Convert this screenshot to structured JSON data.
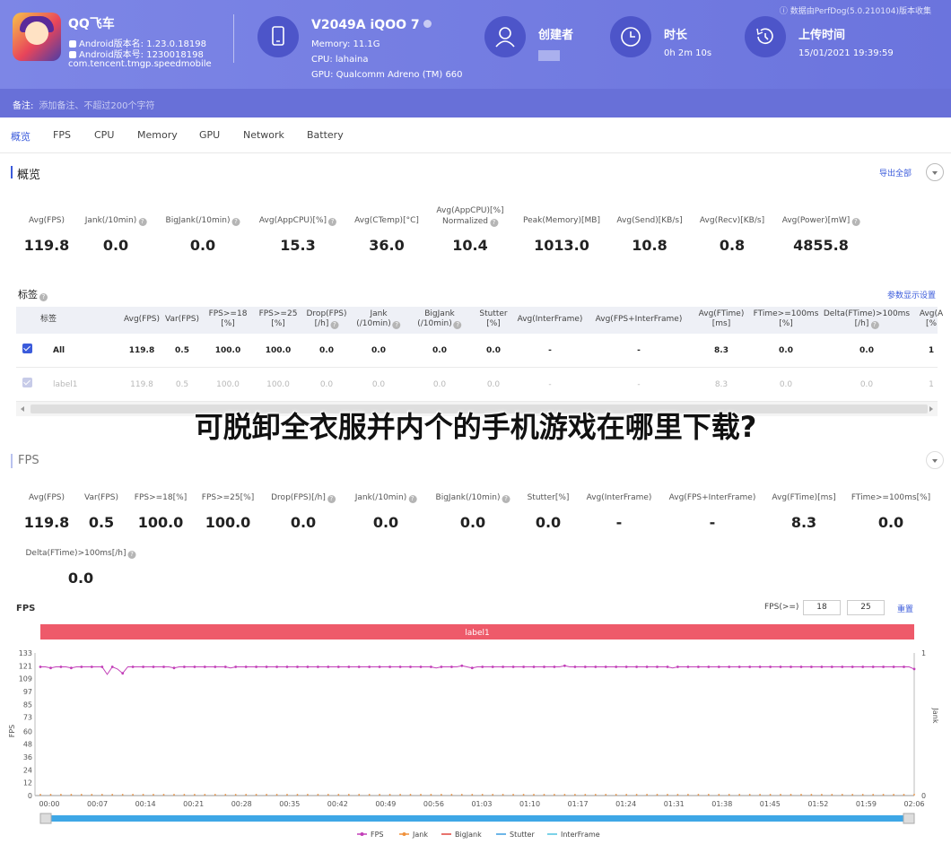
{
  "header": {
    "app_name": "QQ飞车",
    "android_version_name": "Android版本名: 1.23.0.18198",
    "android_version_code": "Android版本号: 1230018198",
    "package": "com.tencent.tmgp.speedmobile",
    "device_name": "V2049A iQOO 7",
    "memory": "Memory: 11.1G",
    "cpu": "CPU: lahaina",
    "gpu": "GPU: Qualcomm Adreno (TM) 660",
    "creator_label": "创建者",
    "duration_label": "时长",
    "duration_value": "0h 2m 10s",
    "upload_label": "上传时间",
    "upload_value": "15/01/2021 19:39:59",
    "source_note": "数据由PerfDog(5.0.210104)版本收集"
  },
  "note": {
    "label": "备注:",
    "placeholder": "添加备注、不超过200个字符"
  },
  "tabs": [
    "概览",
    "FPS",
    "CPU",
    "Memory",
    "GPU",
    "Network",
    "Battery"
  ],
  "overview": {
    "title": "概览",
    "export_label": "导出全部",
    "metrics": [
      {
        "label": "Avg(FPS)",
        "value": "119.8"
      },
      {
        "label": "Jank(/10min)",
        "value": "0.0"
      },
      {
        "label": "BigJank(/10min)",
        "value": "0.0"
      },
      {
        "label": "Avg(AppCPU)[%]",
        "value": "15.3"
      },
      {
        "label": "Avg(CTemp)[°C]",
        "value": "36.0"
      },
      {
        "label": "Avg(AppCPU)[%]",
        "label2": "Normalized",
        "value": "10.4"
      },
      {
        "label": "Peak(Memory)[MB]",
        "value": "1013.0"
      },
      {
        "label": "Avg(Send)[KB/s]",
        "value": "10.8"
      },
      {
        "label": "Avg(Recv)[KB/s]",
        "value": "0.8"
      },
      {
        "label": "Avg(Power)[mW]",
        "value": "4855.8"
      }
    ]
  },
  "tags": {
    "title": "标签",
    "settings_label": "参数显示设置",
    "columns": [
      {
        "l1": "标签",
        "l2": ""
      },
      {
        "l1": "Avg(FPS)",
        "l2": ""
      },
      {
        "l1": "Var(FPS)",
        "l2": ""
      },
      {
        "l1": "FPS>=18",
        "l2": "[%]"
      },
      {
        "l1": "FPS>=25",
        "l2": "[%]"
      },
      {
        "l1": "Drop(FPS)",
        "l2": "[/h]"
      },
      {
        "l1": "Jank",
        "l2": "(/10min)"
      },
      {
        "l1": "BigJank",
        "l2": "(/10min)"
      },
      {
        "l1": "Stutter",
        "l2": "[%]"
      },
      {
        "l1": "Avg(InterFrame)",
        "l2": ""
      },
      {
        "l1": "Avg(FPS+InterFrame)",
        "l2": ""
      },
      {
        "l1": "Avg(FTime)",
        "l2": "[ms]"
      },
      {
        "l1": "FTime>=100ms",
        "l2": "[%]"
      },
      {
        "l1": "Delta(FTime)>100ms",
        "l2": "[/h]"
      },
      {
        "l1": "Avg(A",
        "l2": "[%"
      }
    ],
    "rows": [
      {
        "name": "All",
        "cells": [
          "119.8",
          "0.5",
          "100.0",
          "100.0",
          "0.0",
          "0.0",
          "0.0",
          "0.0",
          "-",
          "-",
          "8.3",
          "0.0",
          "0.0",
          "1"
        ]
      },
      {
        "name": "label1",
        "cells": [
          "119.8",
          "0.5",
          "100.0",
          "100.0",
          "0.0",
          "0.0",
          "0.0",
          "0.0",
          "-",
          "-",
          "8.3",
          "0.0",
          "0.0",
          "1"
        ]
      }
    ]
  },
  "overlay_text": "可脱卸全衣服并内个的手机游戏在哪里下载?",
  "fps_section": {
    "title": "FPS",
    "metrics": [
      {
        "label": "Avg(FPS)",
        "value": "119.8"
      },
      {
        "label": "Var(FPS)",
        "value": "0.5"
      },
      {
        "label": "FPS>=18[%]",
        "value": "100.0"
      },
      {
        "label": "FPS>=25[%]",
        "value": "100.0"
      },
      {
        "label": "Drop(FPS)[/h]",
        "value": "0.0"
      },
      {
        "label": "Jank(/10min)",
        "value": "0.0"
      },
      {
        "label": "BigJank(/10min)",
        "value": "0.0"
      },
      {
        "label": "Stutter[%]",
        "value": "0.0"
      },
      {
        "label": "Avg(InterFrame)",
        "value": "-"
      },
      {
        "label": "Avg(FPS+InterFrame)",
        "value": "-"
      },
      {
        "label": "Avg(FTime)[ms]",
        "value": "8.3"
      },
      {
        "label": "FTime>=100ms[%]",
        "value": "0.0"
      },
      {
        "label": "Delta(FTime)>100ms[/h]",
        "value": "0.0"
      }
    ]
  },
  "chart_controls": {
    "title": "FPS",
    "threshold_label": "FPS(>=)",
    "threshold_1": "18",
    "threshold_2": "25",
    "reset_label": "重置"
  },
  "chart_data": {
    "type": "line",
    "title": "FPS",
    "band_label": "label1",
    "ylabel": "FPS",
    "y2label": "Jank",
    "ylim": [
      0,
      133
    ],
    "yticks": [
      0,
      12,
      24,
      36,
      48,
      60,
      73,
      85,
      97,
      109,
      121,
      133
    ],
    "y2lim": [
      0,
      1
    ],
    "y2ticks": [
      0,
      1
    ],
    "xticks": [
      "00:00",
      "00:07",
      "00:14",
      "00:21",
      "00:28",
      "00:35",
      "00:42",
      "00:49",
      "00:56",
      "01:03",
      "01:10",
      "01:17",
      "01:24",
      "01:31",
      "01:38",
      "01:45",
      "01:52",
      "01:59",
      "02:06"
    ],
    "x_range_seconds": [
      0,
      130
    ],
    "legend": [
      "FPS",
      "Jank",
      "BigJank",
      "Stutter",
      "InterFrame"
    ],
    "legend_colors": [
      "#c23fb8",
      "#f0913b",
      "#e0443c",
      "#3a9ee0",
      "#4fc3e0"
    ],
    "series": [
      {
        "name": "FPS",
        "color": "#c23fb8",
        "values": [
          120,
          120,
          119,
          120,
          120,
          120,
          119,
          120,
          120,
          120,
          120,
          120,
          120,
          113,
          120,
          118,
          114,
          120,
          120,
          120,
          120,
          120,
          120,
          120,
          120,
          120,
          119,
          120,
          120,
          120,
          120,
          120,
          120,
          120,
          120,
          120,
          120,
          119,
          120,
          120,
          120,
          120,
          120,
          120,
          120,
          120,
          120,
          120,
          120,
          120,
          120,
          120,
          120,
          120,
          120,
          120,
          120,
          120,
          120,
          120,
          120,
          120,
          120,
          120,
          120,
          120,
          120,
          120,
          120,
          120,
          120,
          120,
          120,
          120,
          120,
          120,
          120,
          119,
          120,
          120,
          120,
          120,
          121,
          120,
          119,
          120,
          120,
          120,
          120,
          120,
          120,
          120,
          120,
          120,
          120,
          120,
          120,
          120,
          120,
          120,
          120,
          120,
          121,
          120,
          120,
          120,
          120,
          120,
          120,
          120,
          120,
          120,
          120,
          120,
          120,
          120,
          120,
          120,
          120,
          120,
          120,
          120,
          120,
          119,
          120,
          120,
          120,
          120,
          120,
          120,
          120,
          120,
          120,
          120,
          120,
          120,
          120,
          120,
          120,
          120,
          120,
          120,
          120,
          120,
          120,
          120,
          120,
          120,
          120,
          120,
          120,
          120,
          120,
          120,
          120,
          120,
          120,
          120,
          120,
          120,
          120,
          120,
          120,
          120,
          120,
          120,
          120,
          120,
          120,
          120,
          118
        ]
      },
      {
        "name": "Jank",
        "color": "#f0913b",
        "values": "all 0"
      },
      {
        "name": "BigJank",
        "color": "#e0443c",
        "values": "all 0"
      }
    ]
  }
}
